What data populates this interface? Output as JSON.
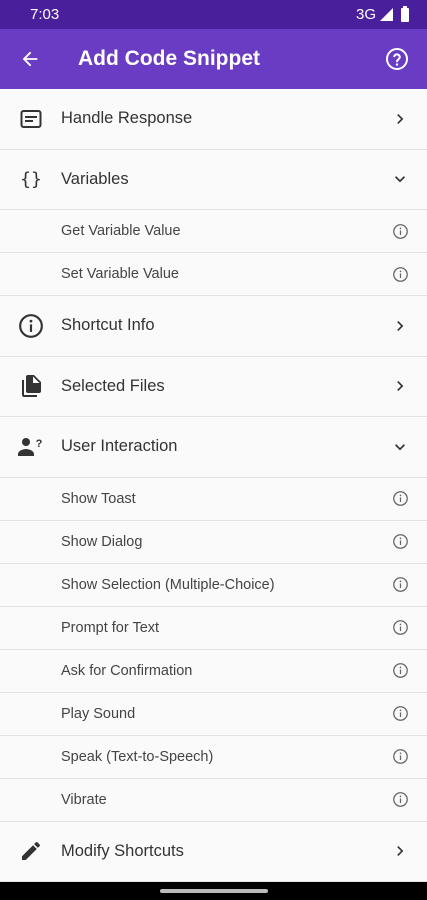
{
  "status": {
    "time": "7:03",
    "network": "3G"
  },
  "app_bar": {
    "title": "Add Code Snippet",
    "back_icon": "arrow-back-icon",
    "help_icon": "help-circle-icon"
  },
  "colors": {
    "status_bar": "#4a1f9c",
    "app_bar": "#6a3cc4",
    "background": "#fafafa",
    "divider": "#e3e3e3"
  },
  "list": [
    {
      "type": "top",
      "label": "Handle Response",
      "icon": "message-box-icon",
      "trail": "chevron-right"
    },
    {
      "type": "top",
      "label": "Variables",
      "icon": "braces-icon",
      "trail": "chevron-down"
    },
    {
      "type": "sub",
      "label": "Get Variable Value",
      "trail": "info"
    },
    {
      "type": "sub",
      "label": "Set Variable Value",
      "trail": "info"
    },
    {
      "type": "top",
      "label": "Shortcut Info",
      "icon": "info-circle-icon",
      "trail": "chevron-right"
    },
    {
      "type": "top",
      "label": "Selected Files",
      "icon": "file-copy-icon",
      "trail": "chevron-right"
    },
    {
      "type": "top",
      "label": "User Interaction",
      "icon": "person-question-icon",
      "trail": "chevron-down"
    },
    {
      "type": "sub",
      "label": "Show Toast",
      "trail": "info"
    },
    {
      "type": "sub",
      "label": "Show Dialog",
      "trail": "info"
    },
    {
      "type": "sub",
      "label": "Show Selection (Multiple-Choice)",
      "trail": "info"
    },
    {
      "type": "sub",
      "label": "Prompt for Text",
      "trail": "info"
    },
    {
      "type": "sub",
      "label": "Ask for Confirmation",
      "trail": "info"
    },
    {
      "type": "sub",
      "label": "Play Sound",
      "trail": "info"
    },
    {
      "type": "sub",
      "label": "Speak (Text-to-Speech)",
      "trail": "info"
    },
    {
      "type": "sub",
      "label": "Vibrate",
      "trail": "info"
    },
    {
      "type": "top",
      "label": "Modify Shortcuts",
      "icon": "pencil-icon",
      "trail": "chevron-right"
    }
  ]
}
